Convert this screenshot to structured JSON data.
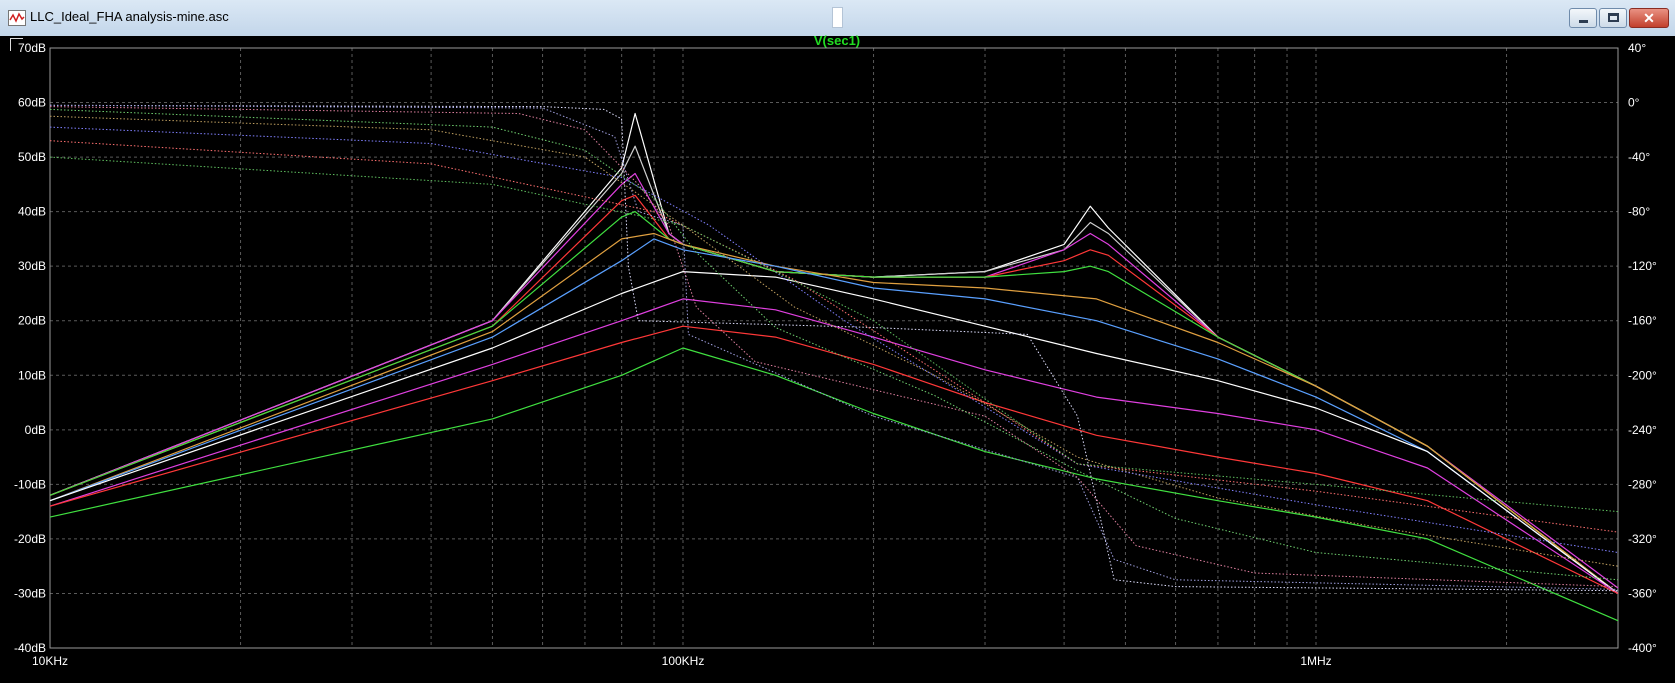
{
  "window": {
    "title": "LLC_Ideal_FHA analysis-mine.asc",
    "close_glyph": "✕"
  },
  "chart_data": {
    "type": "line",
    "title": "V(sec1)",
    "title_color": "#22dd22",
    "x_scale": "log",
    "xlim_hz": [
      10000,
      3000000
    ],
    "x_tick_labels": [
      {
        "value": 10000,
        "label": "10KHz"
      },
      {
        "value": 100000,
        "label": "100KHz"
      },
      {
        "value": 1000000,
        "label": "1MHz"
      }
    ],
    "ylim_db": [
      -40,
      70
    ],
    "y_tick_labels": [
      {
        "value": 70,
        "label": "70dB"
      },
      {
        "value": 60,
        "label": "60dB"
      },
      {
        "value": 50,
        "label": "50dB"
      },
      {
        "value": 40,
        "label": "40dB"
      },
      {
        "value": 30,
        "label": "30dB"
      },
      {
        "value": 20,
        "label": "20dB"
      },
      {
        "value": 10,
        "label": "10dB"
      },
      {
        "value": 0,
        "label": "0dB"
      },
      {
        "value": -10,
        "label": "-10dB"
      },
      {
        "value": -20,
        "label": "-20dB"
      },
      {
        "value": -30,
        "label": "-30dB"
      },
      {
        "value": -40,
        "label": "-40dB"
      }
    ],
    "y2lim_deg": [
      -400,
      40
    ],
    "y2_tick_labels": [
      {
        "value": 40,
        "label": "40°"
      },
      {
        "value": 0,
        "label": "0°"
      },
      {
        "value": -40,
        "label": "-40°"
      },
      {
        "value": -80,
        "label": "-80°"
      },
      {
        "value": -120,
        "label": "-120°"
      },
      {
        "value": -160,
        "label": "-160°"
      },
      {
        "value": -200,
        "label": "-200°"
      },
      {
        "value": -240,
        "label": "-240°"
      },
      {
        "value": -280,
        "label": "-280°"
      },
      {
        "value": -320,
        "label": "-320°"
      },
      {
        "value": -360,
        "label": "-360°"
      },
      {
        "value": -400,
        "label": "-400°"
      }
    ],
    "grid": true,
    "background": "#000000",
    "axis_text_color": "#ffffff",
    "series": [
      {
        "quantity": "magnitude",
        "style": "solid",
        "color": "#ffffff",
        "x": [
          10000,
          50000,
          80000,
          84000,
          95000,
          100000,
          140000,
          200000,
          300000,
          400000,
          440000,
          470000,
          700000,
          1000000,
          1500000,
          3000000
        ],
        "y": [
          -12,
          20,
          48,
          58,
          36,
          34,
          29,
          28,
          29,
          34,
          41,
          37,
          17,
          8,
          -3,
          -30
        ]
      },
      {
        "quantity": "magnitude",
        "style": "solid",
        "color": "#d0d0d0",
        "x": [
          10000,
          50000,
          80000,
          84000,
          95000,
          100000,
          140000,
          200000,
          300000,
          400000,
          440000,
          470000,
          700000,
          1000000,
          1500000,
          3000000
        ],
        "y": [
          -12,
          20,
          47,
          52,
          36,
          34,
          29,
          28,
          29,
          33,
          38,
          36,
          17,
          8,
          -3,
          -30
        ]
      },
      {
        "quantity": "magnitude",
        "style": "solid",
        "color": "#e040e0",
        "x": [
          10000,
          50000,
          80000,
          84000,
          95000,
          100000,
          140000,
          200000,
          300000,
          400000,
          440000,
          470000,
          700000,
          1000000,
          1500000,
          3000000
        ],
        "y": [
          -12,
          20,
          45,
          47,
          36,
          34,
          29,
          28,
          28,
          33,
          36,
          34,
          17,
          8,
          -3,
          -29
        ]
      },
      {
        "quantity": "magnitude",
        "style": "solid",
        "color": "#ff3838",
        "x": [
          10000,
          50000,
          80000,
          84000,
          95000,
          100000,
          140000,
          200000,
          300000,
          400000,
          440000,
          470000,
          700000,
          1000000,
          1500000,
          3000000
        ],
        "y": [
          -12,
          19,
          42,
          43,
          35,
          34,
          29,
          28,
          28,
          31,
          33,
          32,
          17,
          8,
          -3,
          -30
        ]
      },
      {
        "quantity": "magnitude",
        "style": "solid",
        "color": "#40e040",
        "x": [
          10000,
          50000,
          80000,
          84000,
          95000,
          100000,
          140000,
          200000,
          300000,
          400000,
          440000,
          470000,
          700000,
          1000000,
          1500000,
          3000000
        ],
        "y": [
          -12,
          19,
          39,
          40,
          35,
          34,
          29,
          28,
          28,
          29,
          30,
          29,
          17,
          8,
          -3,
          -30
        ]
      },
      {
        "quantity": "magnitude",
        "style": "solid",
        "color": "#e0a040",
        "x": [
          10000,
          50000,
          80000,
          90000,
          100000,
          140000,
          200000,
          300000,
          450000,
          700000,
          1000000,
          1500000,
          3000000
        ],
        "y": [
          -13,
          18,
          35,
          36,
          34,
          30,
          27,
          26,
          24,
          16,
          8,
          -3,
          -30
        ]
      },
      {
        "quantity": "magnitude",
        "style": "solid",
        "color": "#5aa0ff",
        "x": [
          10000,
          50000,
          80000,
          90000,
          100000,
          140000,
          200000,
          300000,
          450000,
          700000,
          1000000,
          1500000,
          3000000
        ],
        "y": [
          -13,
          17,
          31,
          35,
          33,
          30,
          26,
          24,
          20,
          13,
          6,
          -4,
          -30
        ]
      },
      {
        "quantity": "magnitude",
        "style": "solid",
        "color": "#ffffff",
        "x": [
          10000,
          50000,
          80000,
          100000,
          140000,
          200000,
          300000,
          450000,
          700000,
          1000000,
          1500000,
          3000000
        ],
        "y": [
          -13,
          15,
          25,
          29,
          28,
          24,
          19,
          14,
          9,
          4,
          -4,
          -30
        ]
      },
      {
        "quantity": "magnitude",
        "style": "solid",
        "color": "#e040e0",
        "x": [
          10000,
          50000,
          80000,
          100000,
          140000,
          200000,
          300000,
          450000,
          700000,
          1000000,
          1500000,
          3000000
        ],
        "y": [
          -14,
          12,
          20,
          24,
          22,
          17,
          11,
          6,
          3,
          0,
          -7,
          -30
        ]
      },
      {
        "quantity": "magnitude",
        "style": "solid",
        "color": "#ff3838",
        "x": [
          10000,
          50000,
          80000,
          100000,
          140000,
          200000,
          300000,
          450000,
          700000,
          1000000,
          1500000,
          3000000
        ],
        "y": [
          -14,
          9,
          16,
          19,
          17,
          12,
          5,
          -1,
          -5,
          -8,
          -13,
          -30
        ]
      },
      {
        "quantity": "magnitude",
        "style": "solid",
        "color": "#40e040",
        "x": [
          10000,
          50000,
          80000,
          100000,
          140000,
          200000,
          300000,
          450000,
          700000,
          1000000,
          1500000,
          3000000
        ],
        "y": [
          -16,
          2,
          10,
          15,
          10,
          3,
          -4,
          -9,
          -13,
          -16,
          -20,
          -35
        ]
      },
      {
        "quantity": "phase",
        "style": "dotted",
        "color": "#e0e0ff",
        "x": [
          10000,
          60000,
          75000,
          80000,
          82000,
          85000,
          200000,
          350000,
          420000,
          480000,
          600000,
          3000000
        ],
        "y": [
          -2,
          -3,
          -5,
          -12,
          -120,
          -160,
          -165,
          -170,
          -230,
          -350,
          -355,
          -358
        ]
      },
      {
        "quantity": "phase",
        "style": "dotted",
        "color": "#a0a0e0",
        "x": [
          10000,
          60000,
          78000,
          85000,
          100000,
          102000,
          200000,
          420000,
          480000,
          600000,
          3000000
        ],
        "y": [
          -2,
          -4,
          -25,
          -80,
          -90,
          -170,
          -230,
          -275,
          -335,
          -350,
          -357
        ]
      },
      {
        "quantity": "phase",
        "style": "dotted",
        "color": "#e080a0",
        "x": [
          10000,
          55000,
          70000,
          85000,
          95000,
          105000,
          130000,
          300000,
          420000,
          520000,
          800000,
          3000000
        ],
        "y": [
          -3,
          -8,
          -20,
          -60,
          -90,
          -150,
          -190,
          -230,
          -275,
          -325,
          -345,
          -355
        ]
      },
      {
        "quantity": "phase",
        "style": "dotted",
        "color": "#70d070",
        "x": [
          10000,
          50000,
          70000,
          90000,
          105000,
          140000,
          250000,
          420000,
          600000,
          1000000,
          3000000
        ],
        "y": [
          -5,
          -18,
          -35,
          -70,
          -110,
          -165,
          -215,
          -270,
          -305,
          -330,
          -350
        ]
      },
      {
        "quantity": "phase",
        "style": "dotted",
        "color": "#c0a060",
        "x": [
          10000,
          40000,
          70000,
          100000,
          150000,
          250000,
          420000,
          700000,
          1200000,
          3000000
        ],
        "y": [
          -10,
          -20,
          -40,
          -90,
          -150,
          -200,
          -260,
          -290,
          -310,
          -340
        ]
      },
      {
        "quantity": "phase",
        "style": "dotted",
        "color": "#8080ff",
        "x": [
          10000,
          40000,
          80000,
          110000,
          180000,
          420000,
          1000000,
          3000000
        ],
        "y": [
          -18,
          -30,
          -55,
          -90,
          -160,
          -265,
          -295,
          -330
        ]
      },
      {
        "quantity": "phase",
        "style": "dotted",
        "color": "#ff7070",
        "x": [
          10000,
          40000,
          90000,
          150000,
          300000,
          420000,
          1000000,
          3000000
        ],
        "y": [
          -28,
          -45,
          -80,
          -130,
          -220,
          -265,
          -285,
          -315
        ]
      },
      {
        "quantity": "phase",
        "style": "dotted",
        "color": "#60c060",
        "x": [
          10000,
          50000,
          100000,
          200000,
          420000,
          1000000,
          3000000
        ],
        "y": [
          -40,
          -60,
          -90,
          -160,
          -265,
          -280,
          -300
        ]
      }
    ]
  }
}
